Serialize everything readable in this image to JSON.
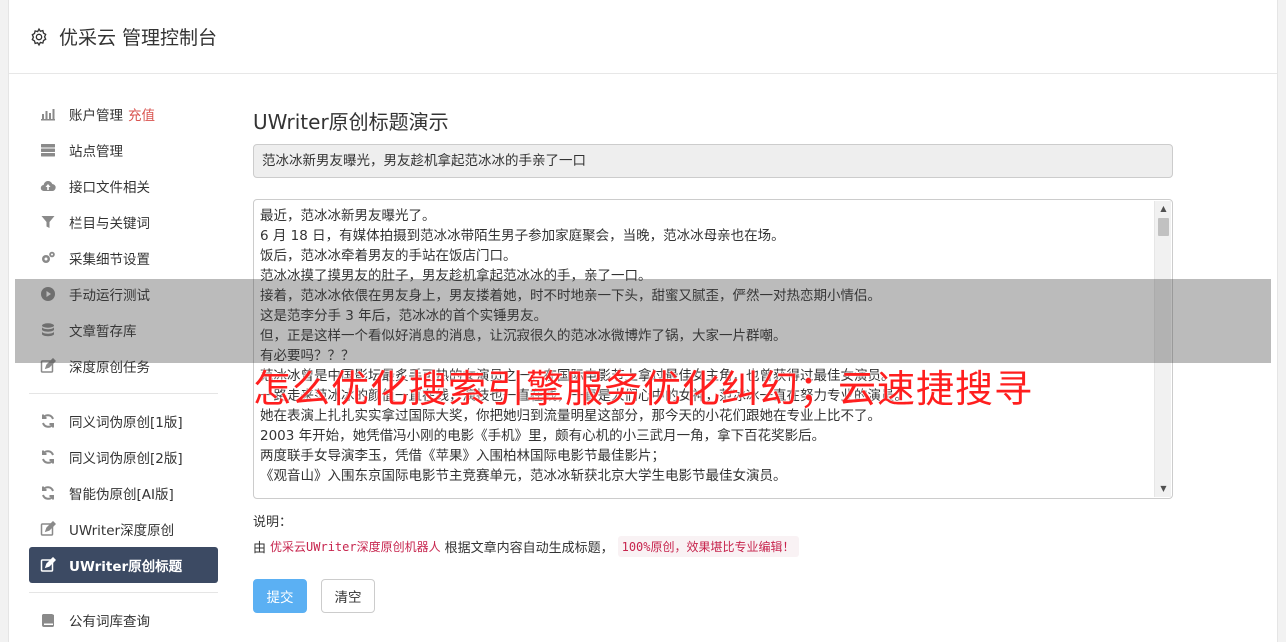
{
  "header": {
    "title": "优采云 管理控制台",
    "icon": "gear-icon"
  },
  "sidebar": {
    "items": [
      {
        "label": "账户管理",
        "badge": "充值",
        "icon": "bar-chart-icon"
      },
      {
        "label": "站点管理",
        "icon": "server-icon"
      },
      {
        "label": "接口文件相关",
        "icon": "cloud-upload-icon"
      },
      {
        "label": "栏目与关键词",
        "icon": "filter-icon"
      },
      {
        "label": "采集细节设置",
        "icon": "gears-icon"
      },
      {
        "label": "手动运行测试",
        "icon": "play-icon"
      },
      {
        "label": "文章暂存库",
        "icon": "database-icon"
      },
      {
        "label": "深度原创任务",
        "icon": "edit-icon"
      },
      {
        "label": "同义词伪原创[1版]",
        "icon": "refresh-icon"
      },
      {
        "label": "同义词伪原创[2版]",
        "icon": "refresh-icon"
      },
      {
        "label": "智能伪原创[AI版]",
        "icon": "refresh-icon"
      },
      {
        "label": "UWriter深度原创",
        "icon": "edit-icon"
      },
      {
        "label": "UWriter原创标题",
        "icon": "edit-icon"
      },
      {
        "label": "公有词库查询",
        "icon": "book-icon"
      }
    ]
  },
  "main": {
    "page_title": "UWriter原创标题演示",
    "generated_title": "范冰冰新男友曝光，男友趁机拿起范冰冰的手亲了一口",
    "article_lines": [
      "最近，范冰冰新男友曝光了。",
      "6 月 18 日，有媒体拍摄到范冰冰带陌生男子参加家庭聚会，当晚，范冰冰母亲也在场。",
      "饭后，范冰冰牵着男友的手站在饭店门口。",
      "范冰冰摸了摸男友的肚子，男友趁机拿起范冰冰的手，亲了一口。",
      "接着，范冰冰依偎在男友身上，男友搂着她，时不时地亲一下头，甜蜜又腻歪，俨然一对热恋期小情侣。",
      "这是范李分手 3 年后，范冰冰的首个实锤男友。",
      "但，正是这样一个看似好消息的消息，让沉寂很久的范冰冰微博炸了锅，大家一片群嘲。",
      "有必要吗？？？",
      "范冰冰曾是中国影坛最炙手可热的女演员之一，在国际电影节上拿过最佳女主角，也曾获得过最佳女演员。",
      "一路走来范冰冰的颜值一直在线，演技也一直在线，一直是人们心中的女神，范冰冰一直在努力专业的演员。",
      "她在表演上扎扎实实拿过国际大奖，你把她归到流量明星这部分，那今天的小花们跟她在专业上比不了。",
      "2003 年开始，她凭借冯小刚的电影《手机》里，颇有心机的小三武月一角，拿下百花奖影后。",
      "两度联手女导演李玉，凭借《苹果》入围柏林国际电影节最佳影片；",
      "《观音山》入围东京国际电影节主竞赛单元，范冰冰斩获北京大学生电影节最佳女演员。"
    ],
    "note_label": "说明：",
    "note_prefix": "由",
    "note_code1": "优采云UWriter深度原创机器人",
    "note_middle": "根据文章内容自动生成标题，",
    "note_code2": "100%原创，效果堪比专业编辑！",
    "submit_label": "提交",
    "clear_label": "清空"
  },
  "watermark": {
    "text": "怎么优化搜索引擎服务优化纠幻；云速捷搜寻",
    "color": "#ff1e1e"
  },
  "colors": {
    "active_nav": "#3c4a63",
    "primary": "#5bb0f3",
    "badge": "#d9534f"
  }
}
